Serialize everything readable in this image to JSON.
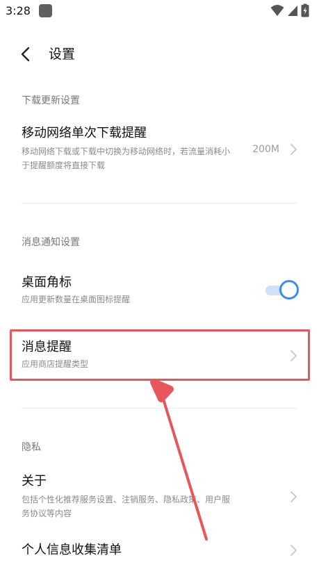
{
  "status_bar": {
    "time": "3:28"
  },
  "top_bar": {
    "title": "设置"
  },
  "sections": {
    "download": {
      "header": "下载更新设置",
      "mobile_download": {
        "title": "移动网络单次下载提醒",
        "subtitle": "移动网络下载或下载中切换为移动网络时，若流量消耗小于提醒额度将直接下载",
        "value": "200M"
      }
    },
    "notify": {
      "header": "消息通知设置",
      "badge": {
        "title": "桌面角标",
        "subtitle": "应用更新数量在桌面图标提醒",
        "enabled": true
      },
      "message_alert": {
        "title": "消息提醒",
        "subtitle": "应用商店提醒类型"
      }
    },
    "privacy": {
      "header": "隐私",
      "about": {
        "title": "关于",
        "subtitle": "包括个性化推荐服务设置、注销服务、隐私政策、用户服务协议等内容"
      },
      "info_list": {
        "title": "个人信息收集清单"
      }
    }
  },
  "colors": {
    "accent": "#3b8bf2",
    "annotation": "#e8555a"
  }
}
